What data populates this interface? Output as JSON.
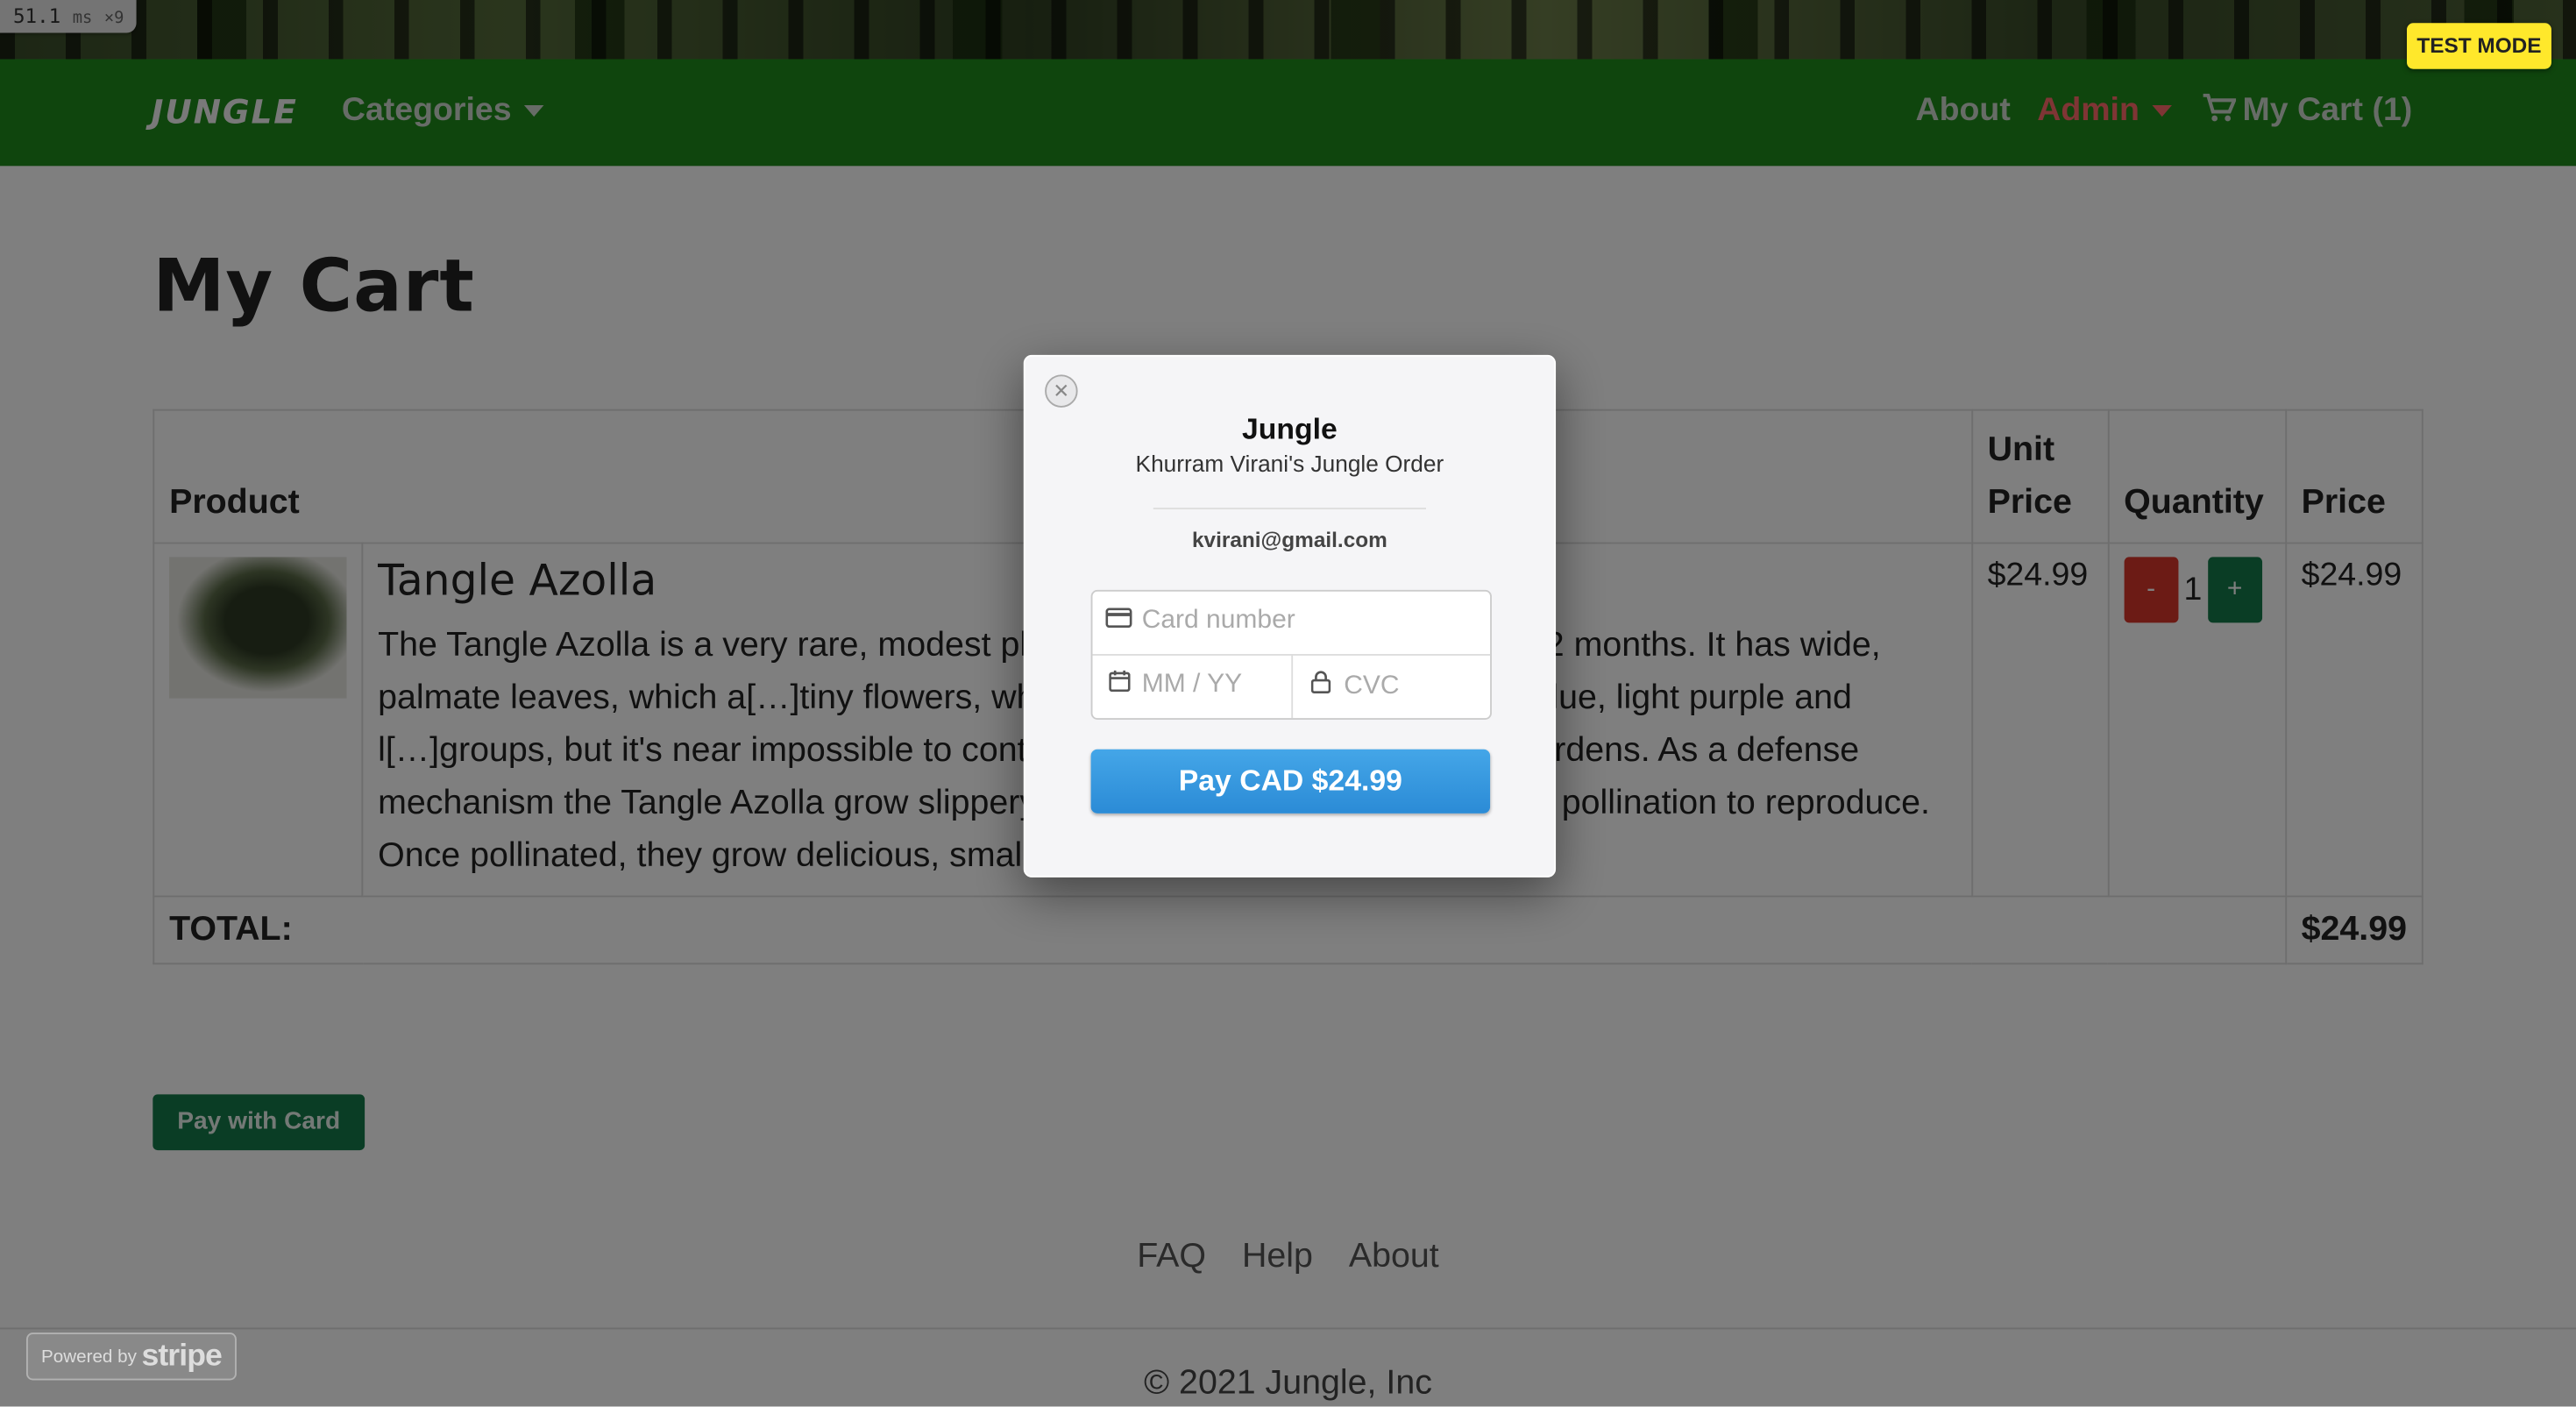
{
  "perf": {
    "value": "51.1",
    "unit": "ms",
    "multiplier": "×9"
  },
  "navbar": {
    "brand": "JUNGLE",
    "categories": "Categories",
    "about": "About",
    "admin": "Admin",
    "cart": "My Cart (1)",
    "test_mode": "TEST MODE"
  },
  "page": {
    "title": "My Cart"
  },
  "table": {
    "headers": {
      "product": "Product",
      "unit_price": "Unit Price",
      "quantity": "Quantity",
      "price": "Price"
    },
    "items": [
      {
        "name": "Tangle Azolla",
        "description": "The Tangle Azolla is a very rare, modest plant[…]. It blooms once a year, for 2 months. It has wide, palmate leaves, which a[…]tiny flowers, which can be light grey, white, light blue, light purple and l[…]groups, but it's near impossible to control and maintain their grov[…]in gardens. As a defense mechanism the Tangle Azolla grow slippery l[…]eaten them. They rely on self pollination to reproduce. Once pollinated, they grow delicious, small fruits.",
        "unit_price": "$24.99",
        "minus": "-",
        "quantity": "1",
        "plus": "+",
        "price": "$24.99"
      }
    ],
    "total_label": "TOTAL:",
    "total_value": "$24.99"
  },
  "pay_with_card": "Pay with Card",
  "footer": {
    "links": [
      "FAQ",
      "Help",
      "About"
    ],
    "copyright": "© 2021 Jungle, Inc"
  },
  "powered_by": {
    "prefix": "Powered by",
    "brand": "stripe"
  },
  "modal": {
    "close": "✕",
    "title": "Jungle",
    "subtitle": "Khurram Virani's Jungle Order",
    "email": "kvirani@gmail.com",
    "card_placeholder": "Card number",
    "expiry_placeholder": "MM / YY",
    "cvc_placeholder": "CVC",
    "pay_label": "Pay CAD $24.99"
  },
  "icons": [
    "caret-down-icon",
    "cart-icon",
    "close-icon",
    "credit-card-icon",
    "calendar-icon",
    "lock-icon"
  ],
  "colors": {
    "navbar": "#1e8a1a",
    "admin": "#ff6b6b",
    "success": "#157a4a",
    "danger": "#d9372b",
    "stripe_blue": "#2b8bd6",
    "test_mode": "#ffe82b"
  }
}
